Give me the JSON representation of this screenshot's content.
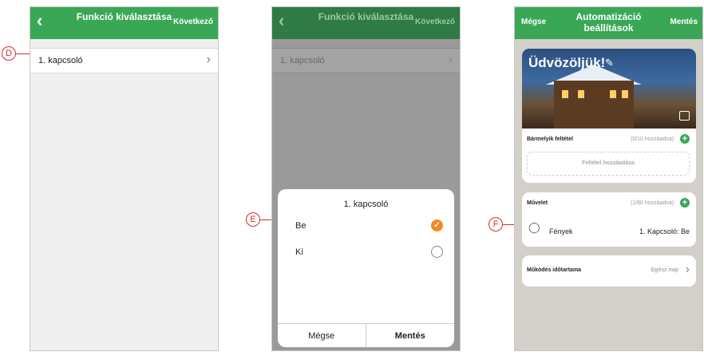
{
  "panel1": {
    "title": "Funkció kiválasztása",
    "next": "Következő",
    "row": "1. kapcsoló"
  },
  "panel2": {
    "title": "Funkció kiválasztása",
    "next": "Következő",
    "row": "1. kapcsoló",
    "sheet": {
      "title": "1. kapcsoló",
      "options": [
        {
          "label": "Be",
          "selected": true
        },
        {
          "label": "Ki",
          "selected": false
        }
      ],
      "cancel": "Mégse",
      "save": "Mentés"
    }
  },
  "panel3": {
    "cancel": "Mégse",
    "title": "Automatizáció beállítások",
    "save": "Mentés",
    "welcome": "Üdvözöljük!",
    "condition": {
      "title": "Bármelyik feltétel",
      "count": "(0/10 hozzáadva)",
      "add": "Feltétel hozzáadása"
    },
    "action": {
      "title": "Művelet",
      "count": "(1/80 hozzáadva)",
      "device": "Fények",
      "value": "1. Kapcsoló: Be"
    },
    "duration": {
      "title": "Működés időtartama",
      "value": "Egész nap"
    }
  },
  "callouts": {
    "d": "D",
    "e": "E",
    "f": "F"
  },
  "colors": {
    "header": "#3aa757",
    "selected": "#f08a24",
    "callout": "#d03030"
  }
}
